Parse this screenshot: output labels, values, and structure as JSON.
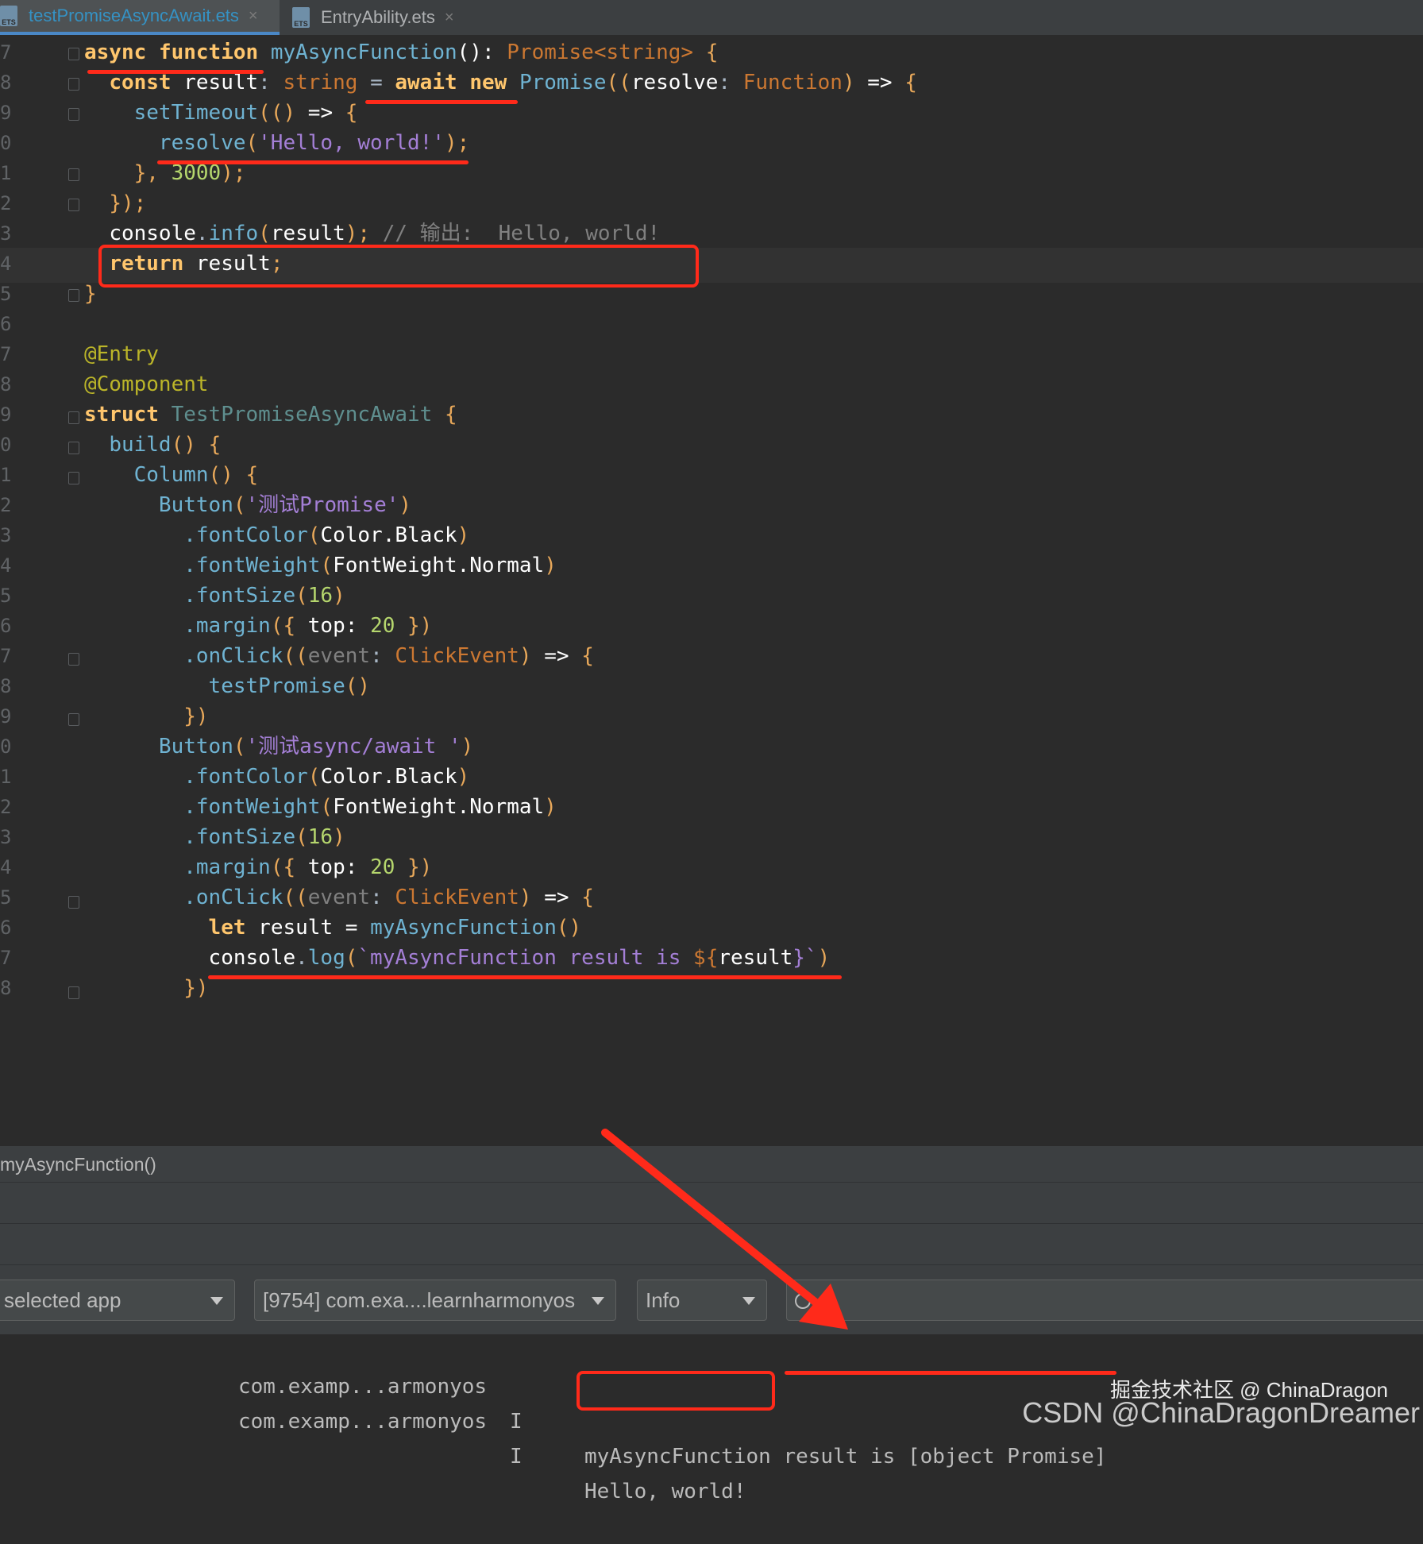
{
  "tabs": [
    {
      "icon": "ets-file-icon",
      "label": "testPromiseAsyncAwait.ets",
      "active": true
    },
    {
      "icon": "ets-file-icon",
      "label": "EntryAbility.ets",
      "active": false
    }
  ],
  "icon_text": "ETS",
  "close_glyph": "×",
  "gutter": [
    "7",
    "8",
    "9",
    "0",
    "1",
    "2",
    "3",
    "4",
    "5",
    "6",
    "7",
    "8",
    "9",
    "0",
    "1",
    "2",
    "3",
    "4",
    "5",
    "6",
    "7",
    "8",
    "9",
    "0",
    "1",
    "2",
    "3",
    "4",
    "5",
    "6",
    "7",
    "8"
  ],
  "code": {
    "l7": {
      "a": "async",
      "b": "function",
      "c": "myAsyncFunction",
      "d": "():",
      "e": "Promise<string>",
      "f": "{"
    },
    "l8": {
      "a": "const",
      "b": "result",
      "c": ":",
      "d": "string",
      "e": "=",
      "f": "await",
      "g": "new",
      "h": "Promise",
      "i": "((",
      "j": "resolve",
      "k": ":",
      "l": "Function",
      "m": ")",
      "n": "=>",
      "o": "{"
    },
    "l9": {
      "a": "setTimeout",
      "b": "(()",
      "c": "=>",
      "d": "{"
    },
    "l10": {
      "a": "resolve",
      "b": "(",
      "c": "'Hello, world!'",
      "d": ");"
    },
    "l11": {
      "a": "},",
      "b": "3000",
      "c": ");"
    },
    "l12": {
      "a": "});"
    },
    "l13": {
      "a": "console",
      "b": ".",
      "c": "info",
      "d": "(",
      "e": "result",
      "f": ");",
      "g": "// 输出:  Hello, world!"
    },
    "l14": {
      "a": "return",
      "b": "result",
      "c": ";"
    },
    "l15": {
      "a": "}"
    },
    "l17": {
      "a": "@Entry"
    },
    "l18": {
      "a": "@Component"
    },
    "l19": {
      "a": "struct",
      "b": "TestPromiseAsyncAwait",
      "c": "{"
    },
    "l20": {
      "a": "build",
      "b": "()",
      "c": "{"
    },
    "l21": {
      "a": "Column",
      "b": "()",
      "c": "{"
    },
    "l22": {
      "a": "Button",
      "b": "(",
      "c": "'测试Promise'",
      "d": ")"
    },
    "l23": {
      "a": ".fontColor",
      "b": "(",
      "c": "Color.Black",
      "d": ")"
    },
    "l24": {
      "a": ".fontWeight",
      "b": "(",
      "c": "FontWeight.Normal",
      "d": ")"
    },
    "l25": {
      "a": ".fontSize",
      "b": "(",
      "c": "16",
      "d": ")"
    },
    "l26": {
      "a": ".margin",
      "b": "({",
      "c": "top:",
      "d": "20",
      "e": "})"
    },
    "l27": {
      "a": ".onClick",
      "b": "((",
      "c": "event",
      "d": ":",
      "e": "ClickEvent",
      "f": ")",
      "g": "=>",
      "h": "{"
    },
    "l28": {
      "a": "testPromise",
      "b": "()"
    },
    "l29": {
      "a": "})"
    },
    "l30": {
      "a": "Button",
      "b": "(",
      "c": "'测试async/await '",
      "d": ")"
    },
    "l31": {
      "a": ".fontColor",
      "b": "(",
      "c": "Color.Black",
      "d": ")"
    },
    "l32": {
      "a": ".fontWeight",
      "b": "(",
      "c": "FontWeight.Normal",
      "d": ")"
    },
    "l33": {
      "a": ".fontSize",
      "b": "(",
      "c": "16",
      "d": ")"
    },
    "l34": {
      "a": ".margin",
      "b": "({",
      "c": "top:",
      "d": "20",
      "e": "})"
    },
    "l35": {
      "a": ".onClick",
      "b": "((",
      "c": "event",
      "d": ":",
      "e": "ClickEvent",
      "f": ")",
      "g": "=>",
      "h": "{"
    },
    "l36": {
      "a": "let",
      "b": "result",
      "c": "=",
      "d": "myAsyncFunction",
      "e": "()"
    },
    "l37": {
      "a": "console",
      "b": ".",
      "c": "log",
      "d": "(",
      "e": "`myAsyncFunction result is ",
      "f": "${",
      "g": "result",
      "h": "}`",
      "i": ")"
    },
    "l38": {
      "a": "})"
    }
  },
  "breadcrumb": "myAsyncFunction()",
  "logcat": {
    "device_select": "selected app",
    "process_select": "[9754] com.exa....learnharmonyos",
    "level_select": "Info",
    "search_placeholder": "",
    "rows": [
      {
        "tag": "com.examp...armonyos",
        "level": "I",
        "msg": "myAsyncFunction result is [object Promise]"
      },
      {
        "tag": "com.examp...armonyos",
        "level": "I",
        "msg": "Hello, world!"
      }
    ]
  },
  "watermark": {
    "line1": "掘金技术社区 @ ChinaDragon",
    "line2": "CSDN @ChinaDragonDreamer"
  },
  "colors": {
    "annotation_red": "#ff2a1a",
    "editor_bg": "#2b2b2b",
    "panel_bg": "#3c3f41"
  }
}
